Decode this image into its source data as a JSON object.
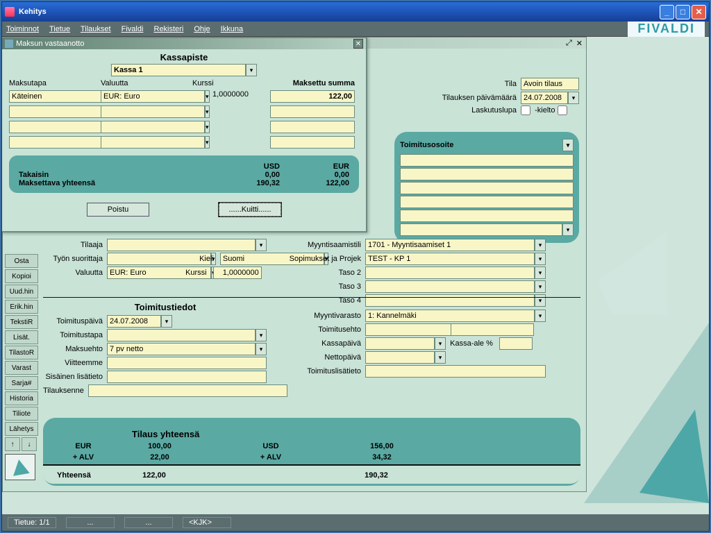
{
  "window": {
    "title": "Kehitys"
  },
  "menus": [
    "Toiminnot",
    "Tietue",
    "Tilaukset",
    "Fivaldi",
    "Rekisteri",
    "Ohje",
    "Ikkuna"
  ],
  "logo": "FIVALDI",
  "sidebar": [
    "Osta",
    "Kopioi",
    "Uud.hin",
    "Erik.hin",
    "TekstiR",
    "Lisät.",
    "TilastoR",
    "Varast",
    "Sarja#",
    "Historia",
    "Tiliote",
    "Lähetys"
  ],
  "top_right": {
    "tila_label": "Tila",
    "tila_value": "Avoin tilaus",
    "pvm_label": "Tilauksen päivämäärä",
    "pvm_value": "24.07.2008",
    "lupa_label": "Laskutuslupa",
    "kielto_label": "-kielto"
  },
  "delivery": {
    "heading": "Toimitusosoite"
  },
  "mid": {
    "tilaaja": "Tilaaja",
    "tyon": "Työn suorittaja",
    "kieli_lbl": "Kieli",
    "kieli_val": "Suomi",
    "valuutta_lbl": "Valuutta",
    "valuutta_val": "EUR: Euro",
    "kurssi_lbl": "Kurssi",
    "kurssi_val": "1,0000000",
    "myyntitili_lbl": "Myyntisaamistili",
    "myyntitili_val": "1701 - Myyntisaamiset 1",
    "sopimus_lbl": "Sopimukset ja Projek",
    "sopimus_val": "TEST - KP 1",
    "taso2": "Taso 2",
    "taso3": "Taso 3",
    "taso4": "Taso 4"
  },
  "toimitus": {
    "heading": "Toimitustiedot",
    "paiva_lbl": "Toimituspäivä",
    "paiva_val": "24.07.2008",
    "tapa_lbl": "Toimitustapa",
    "maksuehto_lbl": "Maksuehto",
    "maksuehto_val": "7 pv netto",
    "viite_lbl": "Viitteemme",
    "sisainen_lbl": "Sisäinen lisätieto",
    "tilauksenne_lbl": "Tilauksenne",
    "varasto_lbl": "Myyntivarasto",
    "varasto_val": "1: Kannelmäki",
    "ehto_lbl": "Toimitusehto",
    "kassa_lbl": "Kassapäivä",
    "kassaale_lbl": "Kassa-ale %",
    "netto_lbl": "Nettopäivä",
    "toimlisa_lbl": "Toimituslisätieto"
  },
  "totals": {
    "heading": "Tilaus yhteensä",
    "eur_lbl": "EUR",
    "eur_val": "100,00",
    "alv_lbl": "+ ALV",
    "alv_eur": "22,00",
    "usd_lbl": "USD",
    "usd_val": "156,00",
    "alv_usd": "34,32",
    "yhteensa_lbl": "Yhteensä",
    "sum_eur": "122,00",
    "sum_usd": "190,32"
  },
  "dialog": {
    "title": "Maksun vastaanotto",
    "kassa_h": "Kassapiste",
    "kassa_val": "Kassa 1",
    "maksutapa_h": "Maksutapa",
    "maksutapa_val": "Käteinen",
    "valuutta_h": "Valuutta",
    "valuutta_val": "EUR: Euro",
    "kurssi_h": "Kurssi",
    "kurssi_val": "1,0000000",
    "maksettu_h": "Maksettu summa",
    "maksettu_val": "122,00",
    "usd_lbl": "USD",
    "eur_lbl": "EUR",
    "takaisin_lbl": "Takaisin",
    "takaisin_usd": "0,00",
    "takaisin_eur": "0,00",
    "yht_lbl": "Maksettava yhteensä",
    "yht_usd": "190,32",
    "yht_eur": "122,00",
    "poistu": "Poistu",
    "kuitti": "......Kuitti......"
  },
  "status": {
    "tietue": "Tietue: 1/1",
    "user": "<KJK>"
  }
}
